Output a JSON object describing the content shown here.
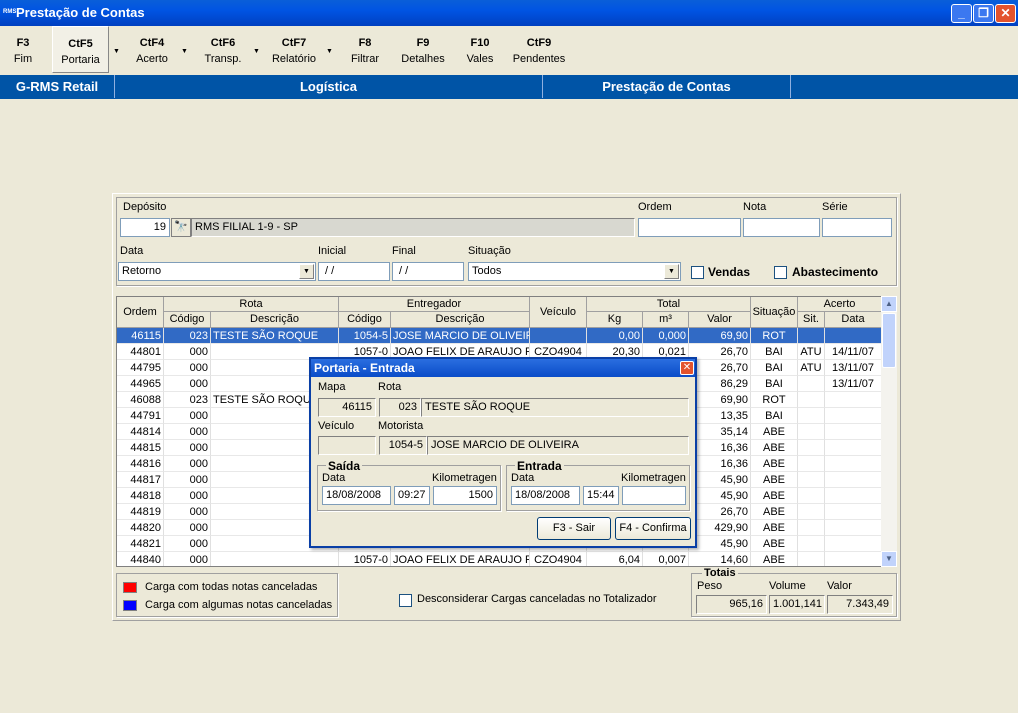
{
  "window": {
    "title": "Prestação de Contas",
    "icon_text": "RMS"
  },
  "toolbar": [
    {
      "key": "F3",
      "label": "Fim"
    },
    {
      "key": "CtF5",
      "label": "Portaria"
    },
    {
      "key": "CtF4",
      "label": "Acerto"
    },
    {
      "key": "CtF6",
      "label": "Transp."
    },
    {
      "key": "CtF7",
      "label": "Relatório"
    },
    {
      "key": "F8",
      "label": "Filtrar"
    },
    {
      "key": "F9",
      "label": "Detalhes"
    },
    {
      "key": "F10",
      "label": "Vales"
    },
    {
      "key": "CtF9",
      "label": "Pendentes"
    }
  ],
  "header_bar": {
    "left": "G-RMS Retail",
    "middle": "Logística",
    "right": "Prestação de Contas"
  },
  "filters": {
    "deposito_label": "Depósito",
    "deposito_code": "19",
    "deposito_name": "RMS FILIAL 1-9 - SP",
    "ordem_label": "Ordem",
    "ordem_value": "",
    "nota_label": "Nota",
    "nota_value": "",
    "serie_label": "Série",
    "serie_value": "",
    "data_label": "Data",
    "data_value": "Retorno",
    "inicial_label": "Inicial",
    "inicial_value": " / /",
    "final_label": "Final",
    "final_value": " / /",
    "situacao_label": "Situação",
    "situacao_value": "Todos",
    "vendas_label": "Vendas",
    "abastecimento_label": "Abastecimento"
  },
  "grid": {
    "groups": {
      "rota": "Rota",
      "entregador": "Entregador",
      "total": "Total",
      "acerto": "Acerto"
    },
    "headers": {
      "ordem": "Ordem",
      "codigo": "Código",
      "descricao": "Descrição",
      "ent_codigo": "Código",
      "ent_descricao": "Descrição",
      "veiculo": "Veículo",
      "kg": "Kg",
      "m3": "m³",
      "valor": "Valor",
      "situacao": "Situação",
      "sit": "Sit.",
      "data": "Data"
    },
    "rows": [
      [
        "46115",
        "023",
        "TESTE SÃO  ROQUE",
        "1054-5",
        "JOSE MARCIO DE OLIVEIRA",
        "",
        "0,00",
        "0,000",
        "69,90",
        "ROT",
        "",
        ""
      ],
      [
        "44801",
        "000",
        "",
        "1057-0",
        "JOAO FELIX DE ARAUJO FII",
        "CZO4904",
        "20,30",
        "0,021",
        "26,70",
        "BAI",
        "ATU",
        "14/11/07"
      ],
      [
        "44795",
        "000",
        "",
        "",
        "",
        "",
        "",
        "",
        "26,70",
        "BAI",
        "ATU",
        "13/11/07"
      ],
      [
        "44965",
        "000",
        "",
        "",
        "",
        "",
        "",
        "",
        "86,29",
        "BAI",
        "",
        "13/11/07"
      ],
      [
        "46088",
        "023",
        "TESTE SÃO  ROQUE",
        "",
        "",
        "",
        "",
        "",
        "69,90",
        "ROT",
        "",
        ""
      ],
      [
        "44791",
        "000",
        "",
        "",
        "",
        "",
        "",
        "",
        "13,35",
        "BAI",
        "",
        ""
      ],
      [
        "44814",
        "000",
        "",
        "",
        "",
        "",
        "",
        "",
        "35,14",
        "ABE",
        "",
        ""
      ],
      [
        "44815",
        "000",
        "",
        "",
        "",
        "",
        "",
        "",
        "16,36",
        "ABE",
        "",
        ""
      ],
      [
        "44816",
        "000",
        "",
        "",
        "",
        "",
        "",
        "",
        "16,36",
        "ABE",
        "",
        ""
      ],
      [
        "44817",
        "000",
        "",
        "",
        "",
        "",
        "",
        "",
        "45,90",
        "ABE",
        "",
        ""
      ],
      [
        "44818",
        "000",
        "",
        "",
        "",
        "",
        "",
        "",
        "45,90",
        "ABE",
        "",
        ""
      ],
      [
        "44819",
        "000",
        "",
        "",
        "",
        "",
        "",
        "",
        "26,70",
        "ABE",
        "",
        ""
      ],
      [
        "44820",
        "000",
        "",
        "",
        "",
        "",
        "",
        "",
        "429,90",
        "ABE",
        "",
        ""
      ],
      [
        "44821",
        "000",
        "",
        "",
        "",
        "",
        "",
        "",
        "45,90",
        "ABE",
        "",
        ""
      ],
      [
        "44840",
        "000",
        "",
        "1057-0",
        "JOAO FELIX DE ARAUJO FII",
        "CZO4904",
        "6,04",
        "0,007",
        "14,60",
        "ABE",
        "",
        ""
      ]
    ]
  },
  "legend": {
    "red_label": "Carga com todas notas canceladas",
    "blue_label": "Carga com algumas notas canceladas",
    "red_color": "#ff0000",
    "blue_color": "#0000ff"
  },
  "desconsiderar_label": "Desconsiderar Cargas canceladas no Totalizador",
  "totais": {
    "title": "Totais",
    "peso_label": "Peso",
    "peso_value": "965,16",
    "volume_label": "Volume",
    "volume_value": "1.001,141",
    "valor_label": "Valor",
    "valor_value": "7.343,49"
  },
  "dialog": {
    "title": "Portaria - Entrada",
    "mapa_label": "Mapa",
    "mapa_value": "46115",
    "rota_label": "Rota",
    "rota_code": "023",
    "rota_name": "TESTE SÃO  ROQUE",
    "veiculo_label": "Veículo",
    "veiculo_value": "",
    "motorista_label": "Motorista",
    "motorista_code": "1054-5",
    "motorista_name": "JOSE MARCIO DE OLIVEIRA",
    "saida_title": "Saída",
    "saida_data_label": "Data",
    "saida_data": "18/08/2008",
    "saida_hora": "09:27",
    "saida_km_label": "Kilometragen",
    "saida_km": "1500",
    "entrada_title": "Entrada",
    "entrada_data_label": "Data",
    "entrada_data": "18/08/2008",
    "entrada_hora": "15:44",
    "entrada_km_label": "Kilometragen",
    "entrada_km": "",
    "btn_sair": "F3 - Sair",
    "btn_confirma": "F4 - Confirma"
  }
}
